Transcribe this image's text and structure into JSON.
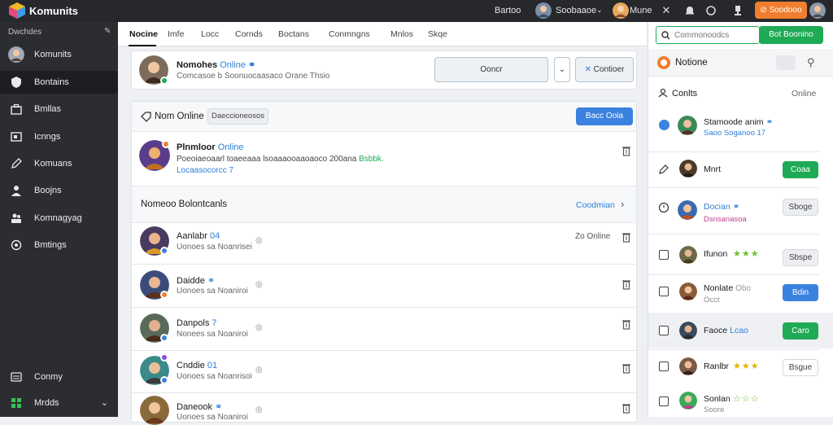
{
  "topbar": {
    "brand": "Komunits",
    "item1": "Bartoo",
    "user1": "Soobaaoe",
    "user2": "Mune",
    "cta": "Soodooo"
  },
  "sidebar": {
    "header": "Dwchdes",
    "profile": "Komunits",
    "items": [
      {
        "label": "Bontains",
        "icon": "shield-icon"
      },
      {
        "label": "Bmllas",
        "icon": "briefcase-icon"
      },
      {
        "label": "Icnngs",
        "icon": "image-icon"
      },
      {
        "label": "Komuans",
        "icon": "pencil-icon"
      },
      {
        "label": "Boojns",
        "icon": "user-icon"
      },
      {
        "label": "Komnagyag",
        "icon": "people-icon"
      },
      {
        "label": "Bmtings",
        "icon": "gear-icon"
      }
    ],
    "bottom1": "Conmy",
    "bottom2": "Mrdds"
  },
  "tabs": [
    "Nocine",
    "Imfe",
    "Locc",
    "Cornds",
    "Boctans",
    "Conmngns",
    "Mnlos",
    "Skqe"
  ],
  "profile_card": {
    "name": "Nomohes",
    "status": "Online",
    "sub": "Comcasoe b Soonuocaasaco Orane Thsio",
    "search_btn": "Ooncr",
    "continue_btn": "Contioer"
  },
  "online_section": {
    "title": "Nom Online",
    "filter": "Daeccioneosos",
    "action": "Bacc Ooia"
  },
  "post": {
    "name": "Plnmloor",
    "status": "Online",
    "line1": "Poeoiaeoaarl toaeeaaa lsoaaaooaaoaoco 200ana",
    "tag": "Bsbbk",
    "line2": "Locaasocorcc",
    "tag2": "7"
  },
  "list_header": {
    "title": "Nomeoo Bolontcanls",
    "link": "Coodmian"
  },
  "list": [
    {
      "name": "Aanlabr",
      "tag": "04",
      "sub": "Uonoes sa Noanrisei",
      "right": "Zo Online"
    },
    {
      "name": "Daidde",
      "tag": "",
      "sub": "Uonoes sa Noaniroi",
      "right": ""
    },
    {
      "name": "Danpols",
      "tag": "7",
      "sub": "Nonees sa Noaniroi",
      "right": ""
    },
    {
      "name": "Cnddie",
      "tag": "01",
      "sub": "Uonoes sa Noanrisoi",
      "right": ""
    },
    {
      "name": "Daneook",
      "tag": "",
      "sub": "Uonoes sa Noaniroi",
      "right": ""
    }
  ],
  "right_panel": {
    "search_placeholder": "Commonoodcs",
    "search_btn": "Bot Boonino",
    "title": "Notione",
    "subtitle": "Conlts",
    "subtitle_right": "Online",
    "items": [
      {
        "name": "Stamoode anim",
        "tag": "",
        "sub": "Saoo Soganoo 17",
        "btn": ""
      },
      {
        "name": "Mnrt",
        "tag": "",
        "sub": "",
        "btn": "Coaa"
      },
      {
        "name": "Docian",
        "tag": "",
        "sub": "Dsnsanasoa",
        "btn": "Sboge"
      },
      {
        "name": "Ifunon",
        "tag": "",
        "sub": "",
        "btn": "Sbspe"
      },
      {
        "name": "Nonlate",
        "tag": "Obo",
        "sub": "Occt",
        "btn": "Bdin"
      },
      {
        "name": "Faoce",
        "tag": "Lcao",
        "sub": "",
        "btn": "Caro"
      },
      {
        "name": "Ranlbr",
        "tag": "",
        "sub": "",
        "btn": "Bsgue"
      },
      {
        "name": "Sonlan",
        "tag": "",
        "sub": "Soore",
        "btn": ""
      }
    ]
  },
  "colors": {
    "accent_green": "#1faa55",
    "accent_blue": "#3b82e0",
    "accent_orange": "#f07e2e",
    "sidebar_bg": "#2b2d31"
  }
}
